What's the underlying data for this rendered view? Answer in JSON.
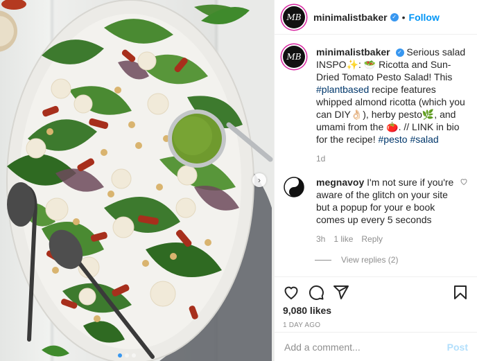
{
  "post": {
    "username": "minimalistbaker",
    "avatar_initials": "MB",
    "follow_label": "Follow",
    "separator": "•"
  },
  "caption": {
    "username": "minimalistbaker",
    "text_1": "Serious salad INSPO",
    "emoji_1": "✨",
    "text_2": ": ",
    "emoji_2": "🥗",
    "text_3": " Ricotta and Sun-Dried Tomato Pesto Salad! This ",
    "hashtag_1": "#plantbased",
    "text_4": " recipe features whipped almond ricotta (which you can DIY",
    "emoji_3": "👌🏻",
    "text_5": "), herby pesto",
    "emoji_4": "🌿",
    "text_6": ", and umami from the ",
    "emoji_5": "🍅",
    "text_7": ". // LINK in bio for the recipe! ",
    "hashtag_2": "#pesto",
    "hashtag_3": "#salad",
    "time": "1d"
  },
  "comment": {
    "username": "megnavoy",
    "text": "I'm not sure if you're aware of the glitch on your site but a popup for your e book comes up every 5 seconds",
    "time": "3h",
    "likes": "1 like",
    "reply_label": "Reply",
    "view_replies": "View replies (2)"
  },
  "footer": {
    "likes": "9,080 likes",
    "date": "1 DAY AGO",
    "add_comment_placeholder": "Add a comment...",
    "post_label": "Post"
  },
  "colors": {
    "accent": "#0095f6",
    "verified": "#3897f0",
    "hashtag": "#00376b",
    "muted": "#8e8e8e"
  },
  "icons": [
    "heart-icon",
    "comment-icon",
    "share-icon",
    "bookmark-icon",
    "chevron-right-icon",
    "verified-badge-icon"
  ]
}
